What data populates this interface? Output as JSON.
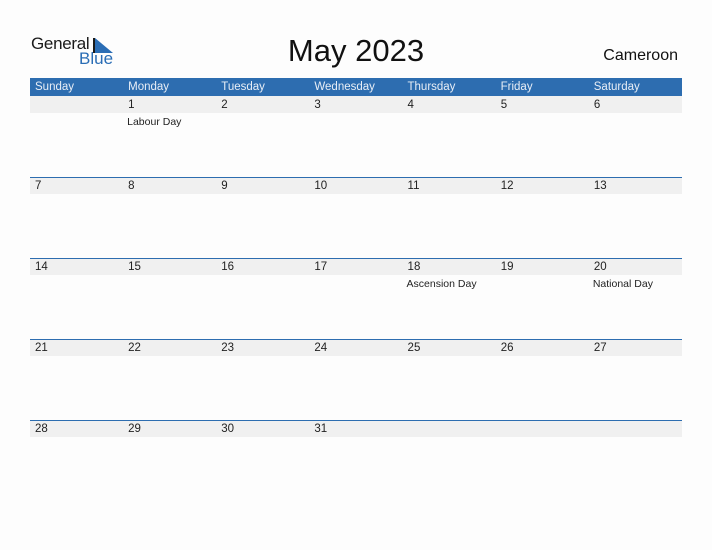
{
  "brand": {
    "general": "General",
    "blue": "Blue"
  },
  "title": "May 2023",
  "country": "Cameroon",
  "colors": {
    "accent": "#2d6db0",
    "strip": "#f0f0f0"
  },
  "weekdays": [
    "Sunday",
    "Monday",
    "Tuesday",
    "Wednesday",
    "Thursday",
    "Friday",
    "Saturday"
  ],
  "weeks": [
    [
      {
        "d": ""
      },
      {
        "d": "1",
        "h": "Labour Day"
      },
      {
        "d": "2"
      },
      {
        "d": "3"
      },
      {
        "d": "4"
      },
      {
        "d": "5"
      },
      {
        "d": "6"
      }
    ],
    [
      {
        "d": "7"
      },
      {
        "d": "8"
      },
      {
        "d": "9"
      },
      {
        "d": "10"
      },
      {
        "d": "11"
      },
      {
        "d": "12"
      },
      {
        "d": "13"
      }
    ],
    [
      {
        "d": "14"
      },
      {
        "d": "15"
      },
      {
        "d": "16"
      },
      {
        "d": "17"
      },
      {
        "d": "18",
        "h": "Ascension Day"
      },
      {
        "d": "19"
      },
      {
        "d": "20",
        "h": "National Day"
      }
    ],
    [
      {
        "d": "21"
      },
      {
        "d": "22"
      },
      {
        "d": "23"
      },
      {
        "d": "24"
      },
      {
        "d": "25"
      },
      {
        "d": "26"
      },
      {
        "d": "27"
      }
    ],
    [
      {
        "d": "28"
      },
      {
        "d": "29"
      },
      {
        "d": "30"
      },
      {
        "d": "31"
      },
      {
        "d": ""
      },
      {
        "d": ""
      },
      {
        "d": ""
      }
    ]
  ]
}
